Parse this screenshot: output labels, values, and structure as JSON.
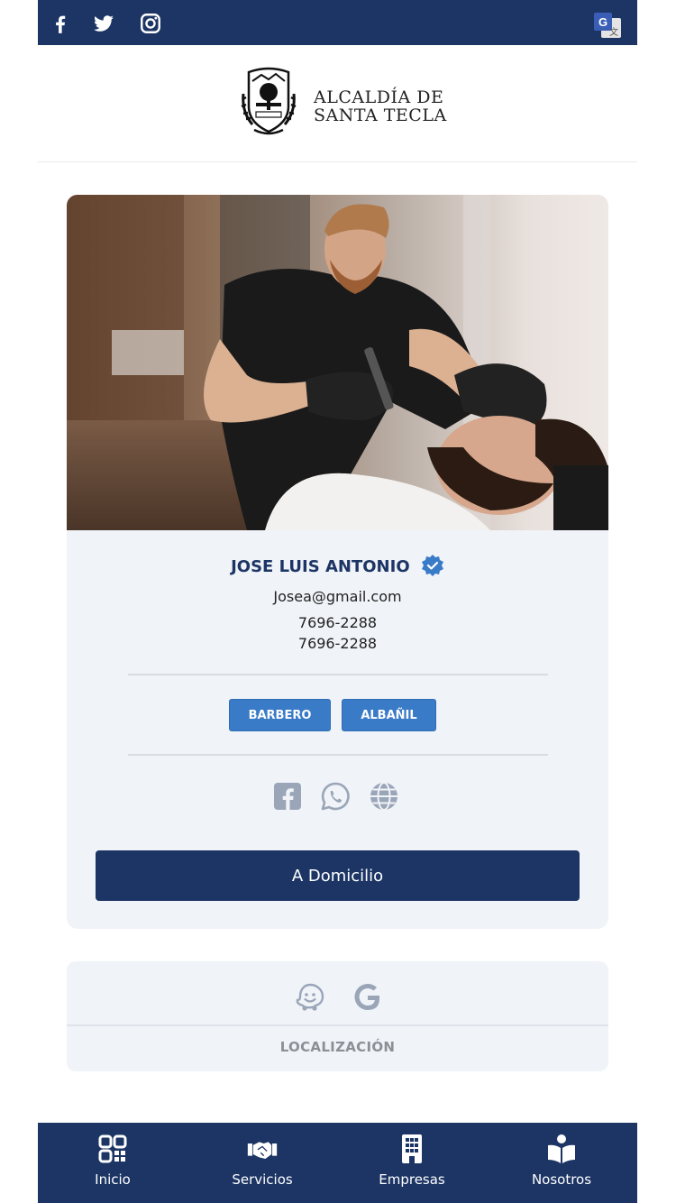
{
  "topbar": {
    "social_icons": [
      "facebook-icon",
      "twitter-icon",
      "instagram-icon"
    ],
    "translate_icon": "google-translate-icon"
  },
  "header": {
    "logo_line1": "ALCALDÍA DE",
    "logo_line2": "SANTA TECLA"
  },
  "profile": {
    "name": "JOSE LUIS ANTONIO",
    "verified": true,
    "email": "Josea@gmail.com",
    "phones": [
      "7696-2288",
      "7696-2288"
    ],
    "tags": [
      "BARBERO",
      "ALBAÑIL"
    ],
    "social_icons": [
      "facebook-icon",
      "whatsapp-icon",
      "globe-icon"
    ],
    "cta_label": "A Domicilio"
  },
  "location": {
    "icons": [
      "waze-icon",
      "google-icon"
    ],
    "label": "LOCALIZACIÓN"
  },
  "bottom_nav": [
    {
      "label": "Inicio",
      "icon": "qr-code-icon"
    },
    {
      "label": "Servicios",
      "icon": "handshake-icon"
    },
    {
      "label": "Empresas",
      "icon": "building-icon"
    },
    {
      "label": "Nosotros",
      "icon": "reader-icon"
    }
  ],
  "colors": {
    "primary": "#1c3565",
    "accent": "#3a7bc8",
    "card_bg": "#f0f3f8",
    "icon_muted": "#9aa6b8"
  }
}
